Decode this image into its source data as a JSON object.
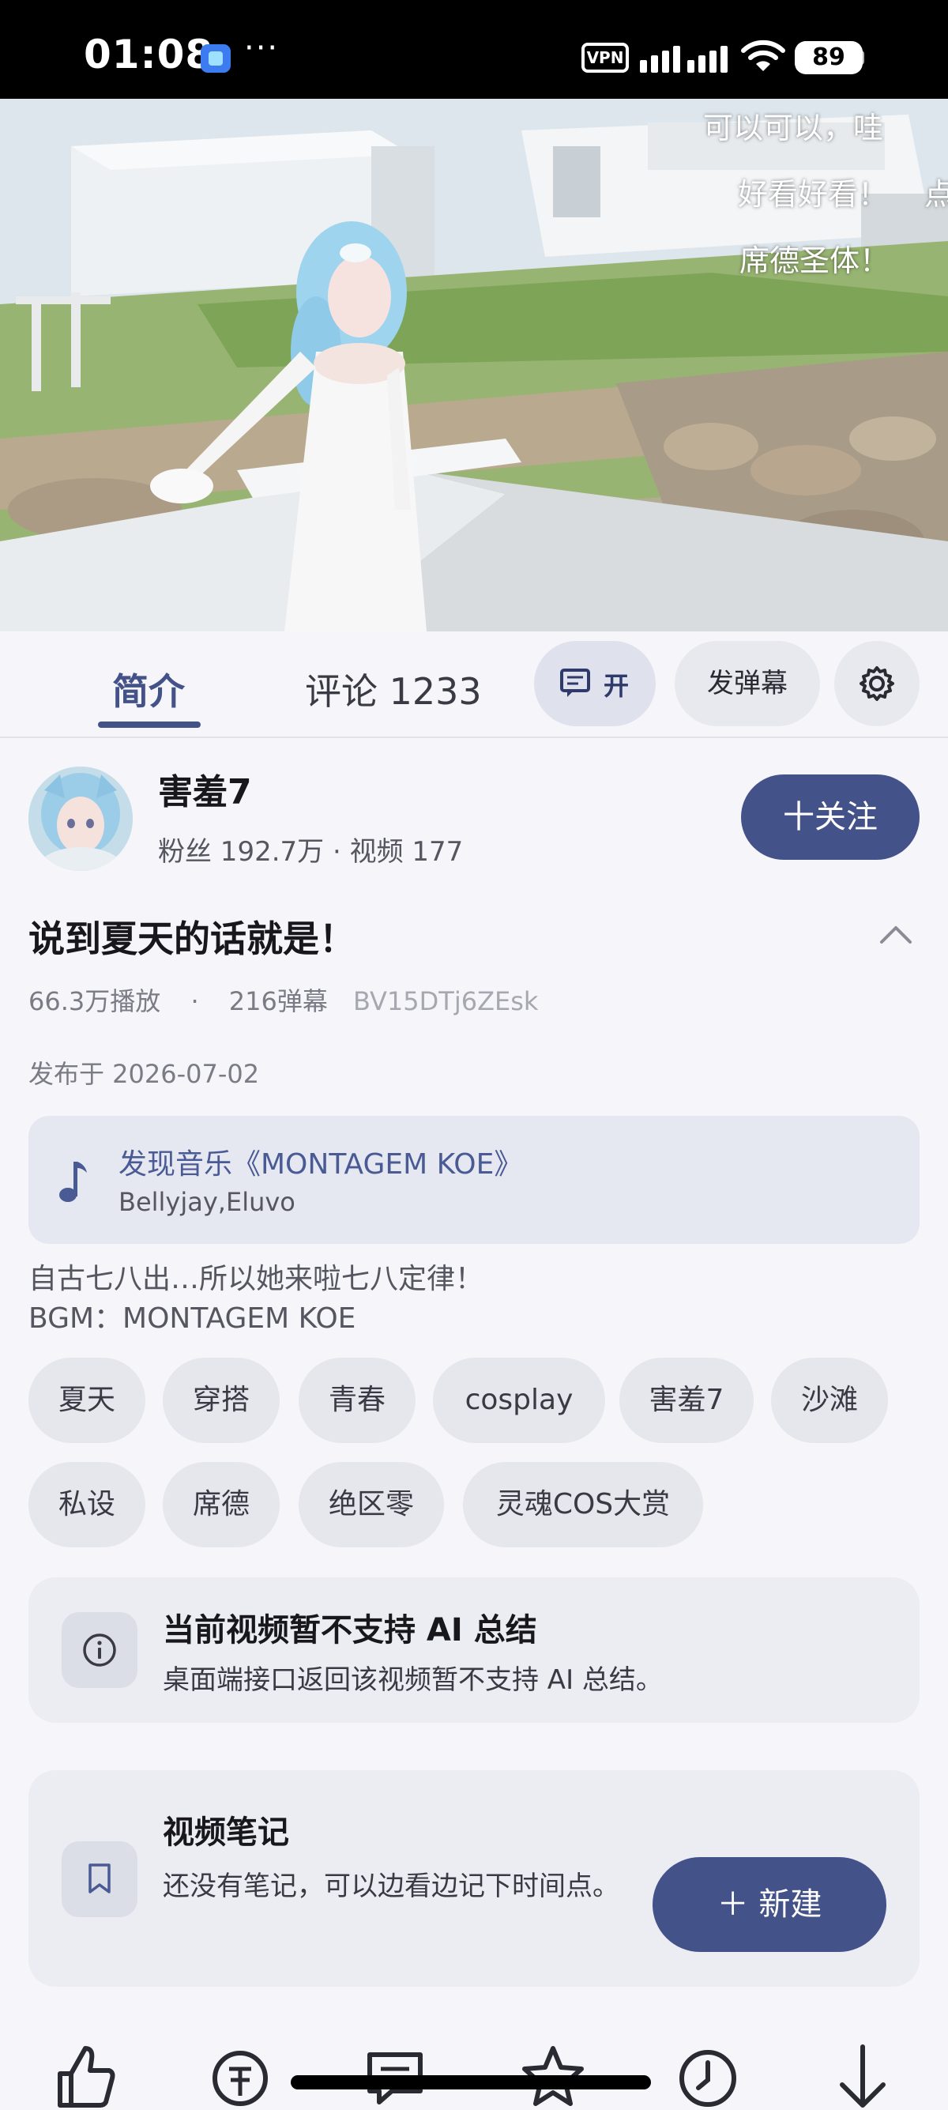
{
  "status_bar": {
    "time": "01:08",
    "dots": "···",
    "vpn": "VPN",
    "battery": "89",
    "icons": [
      "app-icon",
      "signal-icon",
      "wifi-icon",
      "battery-icon"
    ]
  },
  "video": {
    "danmaku": [
      "可以可以，哇",
      "好看好看！",
      "点",
      "席德圣体！"
    ]
  },
  "tabs": {
    "intro": "简介",
    "comments": "评论 1233",
    "danmaku_toggle": "开",
    "send_danmaku": "发弹幕"
  },
  "author": {
    "name": "害羞7",
    "stats": "粉丝 192.7万 · 视频 177",
    "follow": "十关注"
  },
  "video_info": {
    "title": "说到夏天的话就是！",
    "views": "66.3万播放",
    "separator": "·",
    "danmaku_count": "216弹幕",
    "bvid": "BV15DTj6ZEsk",
    "publish_date": "发布于 2026-07-02"
  },
  "music": {
    "title": "发现音乐《MONTAGEM KOE》",
    "artist": "Bellyjay,Eluvo"
  },
  "description": {
    "line1": "自古七八出…所以她来啦七八定律！",
    "line2": "BGM：MONTAGEM KOE"
  },
  "tags": [
    "夏天",
    "穿搭",
    "青春",
    "cosplay",
    "害羞7",
    "沙滩",
    "私设",
    "席德",
    "绝区零",
    "灵魂COS大赏"
  ],
  "ai_summary": {
    "title": "当前视频暂不支持 AI 总结",
    "desc": "桌面端接口返回该视频暂不支持 AI 总结。"
  },
  "notes": {
    "title": "视频笔记",
    "desc": "还没有笔记，可以边看边记下时间点。",
    "new_button": "＋ 新建"
  },
  "bottom_bar": {
    "icons": [
      "like-icon",
      "coin-icon",
      "comment-icon",
      "favorite-icon",
      "watch-later-icon",
      "download-icon"
    ]
  },
  "colors": {
    "accent": "#44528a",
    "background": "#f5f5fa",
    "card": "#ecedf3"
  }
}
